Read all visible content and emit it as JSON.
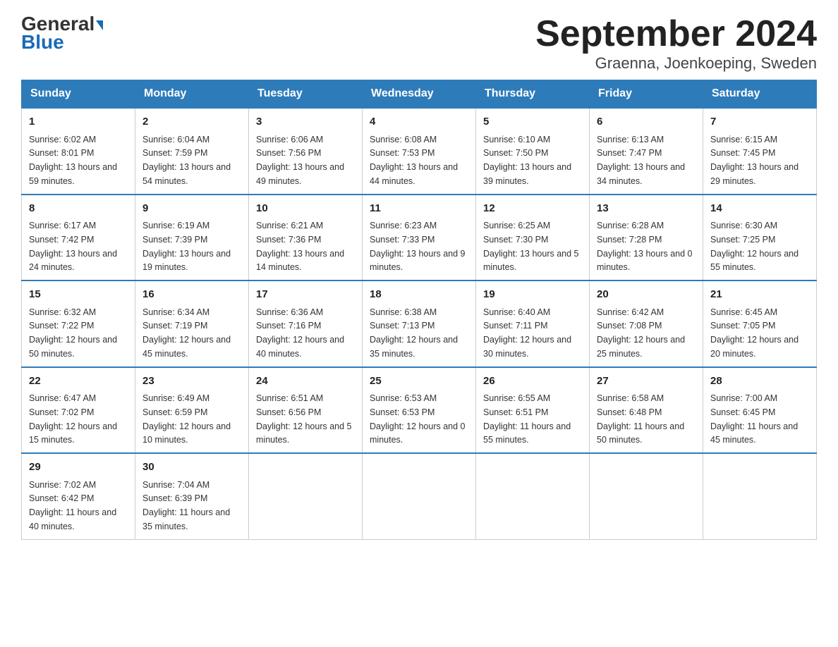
{
  "logo": {
    "general": "General",
    "blue": "Blue"
  },
  "title": "September 2024",
  "subtitle": "Graenna, Joenkoeping, Sweden",
  "weekdays": [
    "Sunday",
    "Monday",
    "Tuesday",
    "Wednesday",
    "Thursday",
    "Friday",
    "Saturday"
  ],
  "weeks": [
    [
      {
        "day": "1",
        "sunrise": "6:02 AM",
        "sunset": "8:01 PM",
        "daylight": "13 hours and 59 minutes."
      },
      {
        "day": "2",
        "sunrise": "6:04 AM",
        "sunset": "7:59 PM",
        "daylight": "13 hours and 54 minutes."
      },
      {
        "day": "3",
        "sunrise": "6:06 AM",
        "sunset": "7:56 PM",
        "daylight": "13 hours and 49 minutes."
      },
      {
        "day": "4",
        "sunrise": "6:08 AM",
        "sunset": "7:53 PM",
        "daylight": "13 hours and 44 minutes."
      },
      {
        "day": "5",
        "sunrise": "6:10 AM",
        "sunset": "7:50 PM",
        "daylight": "13 hours and 39 minutes."
      },
      {
        "day": "6",
        "sunrise": "6:13 AM",
        "sunset": "7:47 PM",
        "daylight": "13 hours and 34 minutes."
      },
      {
        "day": "7",
        "sunrise": "6:15 AM",
        "sunset": "7:45 PM",
        "daylight": "13 hours and 29 minutes."
      }
    ],
    [
      {
        "day": "8",
        "sunrise": "6:17 AM",
        "sunset": "7:42 PM",
        "daylight": "13 hours and 24 minutes."
      },
      {
        "day": "9",
        "sunrise": "6:19 AM",
        "sunset": "7:39 PM",
        "daylight": "13 hours and 19 minutes."
      },
      {
        "day": "10",
        "sunrise": "6:21 AM",
        "sunset": "7:36 PM",
        "daylight": "13 hours and 14 minutes."
      },
      {
        "day": "11",
        "sunrise": "6:23 AM",
        "sunset": "7:33 PM",
        "daylight": "13 hours and 9 minutes."
      },
      {
        "day": "12",
        "sunrise": "6:25 AM",
        "sunset": "7:30 PM",
        "daylight": "13 hours and 5 minutes."
      },
      {
        "day": "13",
        "sunrise": "6:28 AM",
        "sunset": "7:28 PM",
        "daylight": "13 hours and 0 minutes."
      },
      {
        "day": "14",
        "sunrise": "6:30 AM",
        "sunset": "7:25 PM",
        "daylight": "12 hours and 55 minutes."
      }
    ],
    [
      {
        "day": "15",
        "sunrise": "6:32 AM",
        "sunset": "7:22 PM",
        "daylight": "12 hours and 50 minutes."
      },
      {
        "day": "16",
        "sunrise": "6:34 AM",
        "sunset": "7:19 PM",
        "daylight": "12 hours and 45 minutes."
      },
      {
        "day": "17",
        "sunrise": "6:36 AM",
        "sunset": "7:16 PM",
        "daylight": "12 hours and 40 minutes."
      },
      {
        "day": "18",
        "sunrise": "6:38 AM",
        "sunset": "7:13 PM",
        "daylight": "12 hours and 35 minutes."
      },
      {
        "day": "19",
        "sunrise": "6:40 AM",
        "sunset": "7:11 PM",
        "daylight": "12 hours and 30 minutes."
      },
      {
        "day": "20",
        "sunrise": "6:42 AM",
        "sunset": "7:08 PM",
        "daylight": "12 hours and 25 minutes."
      },
      {
        "day": "21",
        "sunrise": "6:45 AM",
        "sunset": "7:05 PM",
        "daylight": "12 hours and 20 minutes."
      }
    ],
    [
      {
        "day": "22",
        "sunrise": "6:47 AM",
        "sunset": "7:02 PM",
        "daylight": "12 hours and 15 minutes."
      },
      {
        "day": "23",
        "sunrise": "6:49 AM",
        "sunset": "6:59 PM",
        "daylight": "12 hours and 10 minutes."
      },
      {
        "day": "24",
        "sunrise": "6:51 AM",
        "sunset": "6:56 PM",
        "daylight": "12 hours and 5 minutes."
      },
      {
        "day": "25",
        "sunrise": "6:53 AM",
        "sunset": "6:53 PM",
        "daylight": "12 hours and 0 minutes."
      },
      {
        "day": "26",
        "sunrise": "6:55 AM",
        "sunset": "6:51 PM",
        "daylight": "11 hours and 55 minutes."
      },
      {
        "day": "27",
        "sunrise": "6:58 AM",
        "sunset": "6:48 PM",
        "daylight": "11 hours and 50 minutes."
      },
      {
        "day": "28",
        "sunrise": "7:00 AM",
        "sunset": "6:45 PM",
        "daylight": "11 hours and 45 minutes."
      }
    ],
    [
      {
        "day": "29",
        "sunrise": "7:02 AM",
        "sunset": "6:42 PM",
        "daylight": "11 hours and 40 minutes."
      },
      {
        "day": "30",
        "sunrise": "7:04 AM",
        "sunset": "6:39 PM",
        "daylight": "11 hours and 35 minutes."
      },
      null,
      null,
      null,
      null,
      null
    ]
  ]
}
